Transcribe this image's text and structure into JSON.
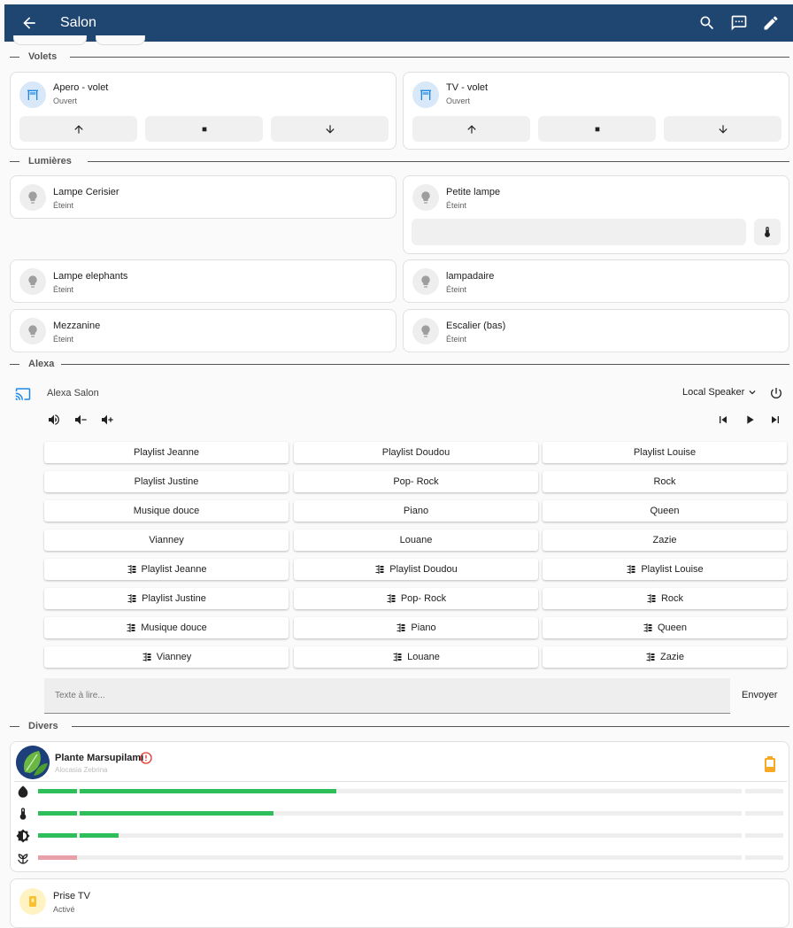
{
  "header": {
    "title": "Salon",
    "back_icon": "arrow-left-icon",
    "search_icon": "search-icon",
    "assist_icon": "chat-icon",
    "edit_icon": "pencil-icon",
    "bg_color": "#1f4571"
  },
  "sections": {
    "volets": "Volets",
    "lumieres": "Lumières",
    "alexa": "Alexa",
    "divers": "Divers"
  },
  "covers": [
    {
      "name": "Apero - volet",
      "state": "Ouvert",
      "icon": "window-shutter-open-icon"
    },
    {
      "name": "TV - volet",
      "state": "Ouvert",
      "icon": "window-shutter-open-icon"
    }
  ],
  "cover_controls": [
    "arrow-up-icon",
    "stop-icon",
    "arrow-down-icon"
  ],
  "lights": [
    {
      "name": "Lampe Cerisier",
      "state": "Éteint"
    },
    {
      "name": "Petite lampe",
      "state": "Éteint",
      "extra_icon": "thermometer-icon"
    },
    {
      "name": "Lampe elephants",
      "state": "Éteint"
    },
    {
      "name": "lampadaire",
      "state": "Éteint"
    },
    {
      "name": "Mezzanine",
      "state": "Éteint"
    },
    {
      "name": "Escalier (bas)",
      "state": "Éteint"
    }
  ],
  "alexa": {
    "device": "Alexa Salon",
    "source": "Local Speaker",
    "cast_icon": "cast-icon",
    "power_icon": "power-icon",
    "volume_icons": [
      "volume-mute-icon",
      "volume-down-icon",
      "volume-up-icon"
    ],
    "transport_icons": [
      "skip-previous-icon",
      "play-icon",
      "skip-next-icon"
    ],
    "buttons": [
      "Playlist Jeanne",
      "Playlist Doudou",
      "Playlist Louise",
      "Playlist Justine",
      "Pop- Rock",
      "Rock",
      "Musique douce",
      "Piano",
      "Queen",
      "Vianney",
      "Louane",
      "Zazie"
    ],
    "group_buttons": [
      "Playlist Jeanne",
      "Playlist Doudou",
      "Playlist Louise",
      "Playlist Justine",
      "Pop- Rock",
      "Rock",
      "Musique douce",
      "Piano",
      "Queen",
      "Vianney",
      "Louane",
      "Zazie"
    ],
    "tts_placeholder": "Texte à lire...",
    "send_label": "Envoyer"
  },
  "plant": {
    "name": "Plante Marsupilami",
    "species": "Alocasia Zebrina",
    "alert_icon": "alert-circle-icon",
    "battery_icon": "battery-low-icon",
    "sensors": [
      {
        "icon": "water-drop-icon",
        "level_pct": 37,
        "color": "#2fbf5a"
      },
      {
        "icon": "thermometer-icon",
        "level_pct": 28,
        "color": "#2fbf5a"
      },
      {
        "icon": "brightness-icon",
        "level_pct": 6,
        "color": "#2fbf5a"
      },
      {
        "icon": "fertilizer-icon",
        "level_pct": 5,
        "color": "#e8a0a8"
      }
    ]
  },
  "switch": {
    "name": "Prise TV",
    "state": "Activé",
    "icon": "power-socket-icon",
    "color": "#fbc02d"
  }
}
